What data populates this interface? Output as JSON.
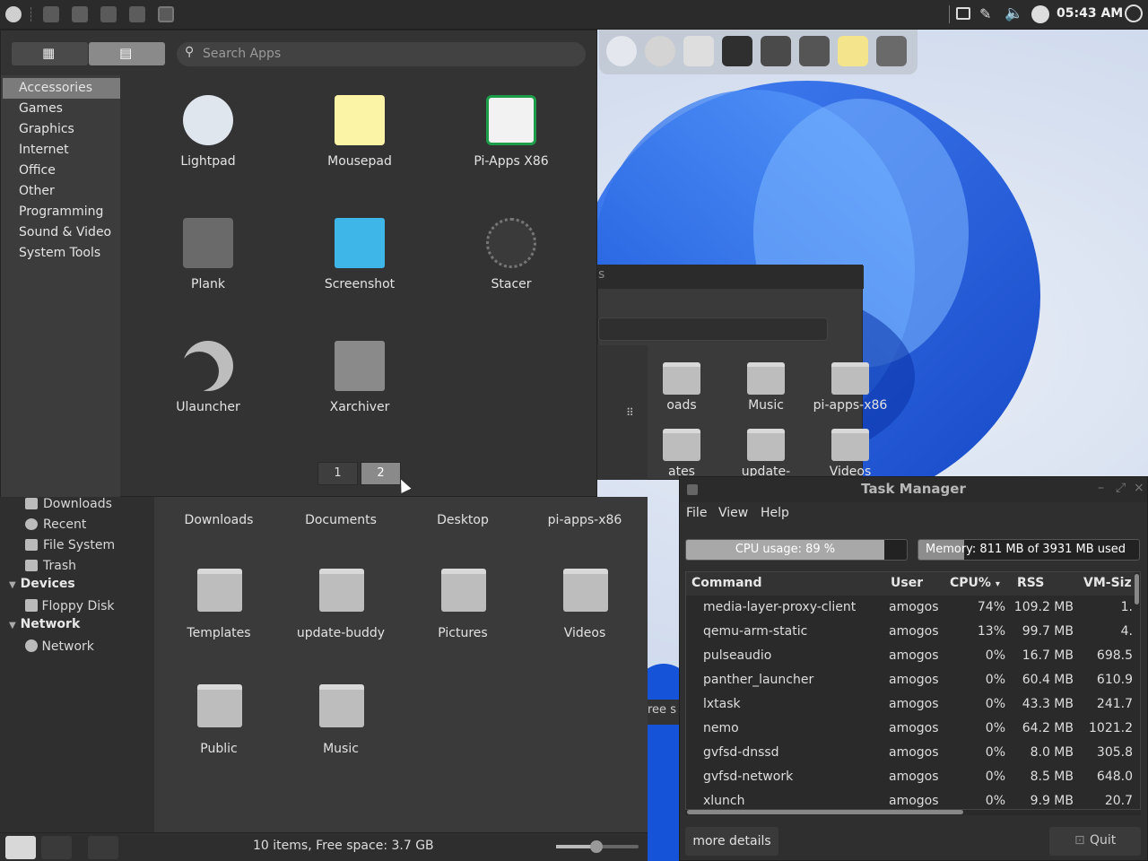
{
  "top_panel": {
    "clock": "05:43 AM",
    "icons": [
      "app-menu-icon",
      "folder-icon",
      "window-icon",
      "window-icon",
      "folder-icon",
      "record-icon"
    ],
    "tray_icons": [
      "screen-icon",
      "paperclip-icon",
      "volume-icon",
      "search-icon",
      "power-icon"
    ]
  },
  "dock": {
    "items": [
      "lightpad-icon",
      "ulauncher-icon",
      "window-icon",
      "terminal-icon",
      "calculator-icon",
      "files-icon",
      "mousepad-icon",
      "trash-icon"
    ]
  },
  "app_menu": {
    "search_placeholder": "Search Apps",
    "categories": [
      "Accessories",
      "Games",
      "Graphics",
      "Internet",
      "Office",
      "Other",
      "Programming",
      "Sound & Video",
      "System Tools"
    ],
    "selected_category": "Accessories",
    "apps": [
      {
        "name": "Lightpad",
        "icon": "rocket-icon"
      },
      {
        "name": "Mousepad",
        "icon": "notepad-icon"
      },
      {
        "name": "Pi-Apps X86",
        "icon": "shopping-bag-icon"
      },
      {
        "name": "Plank",
        "icon": "anchor-icon"
      },
      {
        "name": "Screenshot",
        "icon": "screenshot-icon"
      },
      {
        "name": "Stacer",
        "icon": "gauge-icon"
      },
      {
        "name": "Ulauncher",
        "icon": "moon-icon"
      },
      {
        "name": "Xarchiver",
        "icon": "archive-icon"
      }
    ],
    "pages": [
      "1",
      "2"
    ],
    "current_page": "2"
  },
  "file_manager": {
    "sidebar": {
      "items_top": [
        "Downloads",
        "Recent",
        "File System",
        "Trash"
      ],
      "devices_label": "Devices",
      "devices": [
        "Floppy Disk"
      ],
      "network_label": "Network",
      "network": [
        "Network"
      ]
    },
    "folders": [
      {
        "name": "Downloads",
        "icon": "folder-icon"
      },
      {
        "name": "Documents",
        "icon": "folder-icon"
      },
      {
        "name": "Desktop",
        "icon": "folder-icon"
      },
      {
        "name": "pi-apps-x86",
        "icon": "folder-icon"
      },
      {
        "name": "Templates",
        "icon": "templates-folder-icon"
      },
      {
        "name": "update-buddy",
        "icon": "folder-icon"
      },
      {
        "name": "Pictures",
        "icon": "pictures-folder-icon"
      },
      {
        "name": "Videos",
        "icon": "videos-folder-icon"
      },
      {
        "name": "Public",
        "icon": "public-folder-icon"
      },
      {
        "name": "Music",
        "icon": "music-folder-icon"
      }
    ],
    "status": "10 items, Free space: 3.7 GB"
  },
  "bg_window": {
    "folders": [
      {
        "name": "oads",
        "icon": "folder-icon"
      },
      {
        "name": "Music",
        "icon": "music-folder-icon"
      },
      {
        "name": "pi-apps-x86",
        "icon": "folder-icon"
      },
      {
        "name": "ates",
        "icon": "folder-icon"
      },
      {
        "name": "update-",
        "icon": "folder-icon"
      },
      {
        "name": "Videos",
        "icon": "videos-folder-icon"
      }
    ],
    "title_fragment": "s",
    "status_fragment": "ree s"
  },
  "task_manager": {
    "title": "Task Manager",
    "menu": [
      "File",
      "View",
      "Help"
    ],
    "cpu_label": "CPU usage: 89 %",
    "cpu_fraction": 0.89,
    "memory_label": "Memory: 811 MB of 3931 MB used",
    "memory_fraction": 0.206,
    "columns": [
      "Command",
      "User",
      "CPU%",
      "RSS",
      "VM-Siz"
    ],
    "rows": [
      [
        "media-layer-proxy-client",
        "amogos",
        "74%",
        "109.2 MB",
        "1."
      ],
      [
        "qemu-arm-static",
        "amogos",
        "13%",
        "99.7 MB",
        "4."
      ],
      [
        "pulseaudio",
        "amogos",
        "0%",
        "16.7 MB",
        "698.5"
      ],
      [
        "panther_launcher",
        "amogos",
        "0%",
        "60.4 MB",
        "610.9"
      ],
      [
        "lxtask",
        "amogos",
        "0%",
        "43.3 MB",
        "241.7"
      ],
      [
        "nemo",
        "amogos",
        "0%",
        "64.2 MB",
        "1021.2"
      ],
      [
        "gvfsd-dnssd",
        "amogos",
        "0%",
        "8.0 MB",
        "305.8"
      ],
      [
        "gvfsd-network",
        "amogos",
        "0%",
        "8.5 MB",
        "648.0"
      ],
      [
        "xlunch",
        "amogos",
        "0%",
        "9.9 MB",
        "20.7"
      ]
    ],
    "more_details": "more details",
    "quit": "Quit"
  }
}
